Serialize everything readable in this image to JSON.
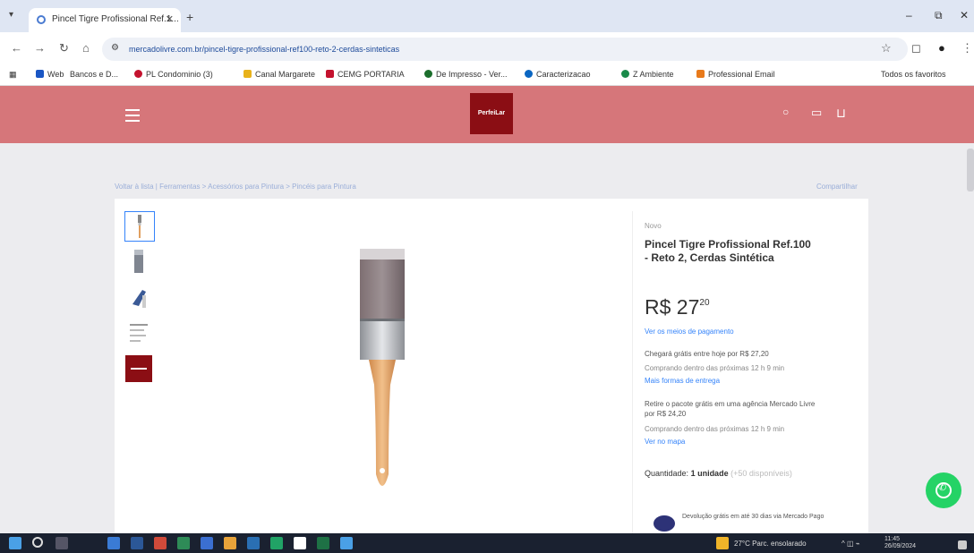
{
  "browser": {
    "tab_title": "Pincel Tigre Profissional Ref.1...",
    "url": "mercadolivre.com.br/pincel-tigre-profissional-ref100-reto-2-cerdas-sinteticas",
    "bookmarks": [
      "Web",
      "Bancos e D...",
      "PL Condominio (3)",
      "Canal Margarete",
      "CEMG PORTARIA",
      "De Impresso - Ver...",
      "Caracterizacao",
      "Z Ambiente",
      "Professional Email"
    ],
    "all_bookmarks": "Todos os favoritos"
  },
  "site": {
    "logo_text": "PerfeiLar",
    "breadcrumb": "Voltar à lista | Ferramentas > Acessórios para Pintura > Pincéis para Pintura",
    "share": "Compartilhar",
    "colors": {
      "header": "#d6767a",
      "logo_bg": "#8b0e14",
      "link": "#3483fa"
    }
  },
  "product": {
    "condition": "Novo",
    "title": "Pincel Tigre Profissional Ref.100 - Reto 2, Cerdas Sintética",
    "price_currency": "R$",
    "price_int": "27",
    "price_cents": "20",
    "installments_link": "Ver os meios de pagamento",
    "delivery_1": "Chegará grátis entre hoje por R$ 27,20",
    "delivery_1_note": "Comprando dentro das próximas 12 h 9 min",
    "delivery_1_link": "Mais formas de entrega",
    "delivery_2": "Retire o pacote grátis em uma agência Mercado Livre por R$ 24,20",
    "delivery_2_note": "Comprando dentro das próximas 12 h 9 min",
    "delivery_2_link": "Ver no mapa",
    "qty_label": "Quantidade:",
    "qty_value": "1 unidade",
    "qty_available": "(+50 disponíveis)",
    "meli_text": "Devolução grátis em até 30 dias via Mercado Pago"
  },
  "taskbar": {
    "weather": "27°C  Parc. ensolarado",
    "time": "11:45",
    "date": "26/09/2024"
  }
}
